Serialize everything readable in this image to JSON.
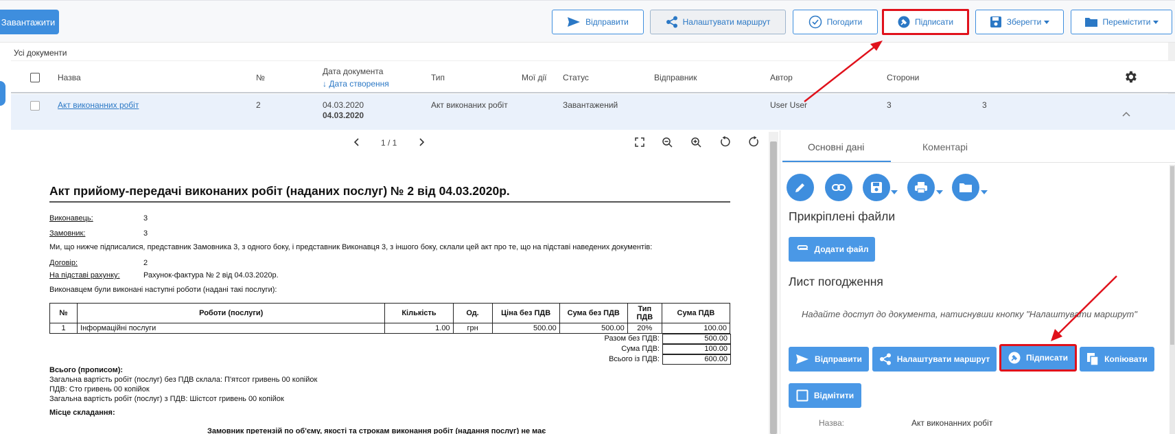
{
  "toolbar": {
    "upload": "Завантажити",
    "send": "Відправити",
    "route": "Налаштувати маршрут",
    "approve": "Погодити",
    "sign": "Підписати",
    "save": "Зберегти",
    "move": "Перемістити"
  },
  "breadcrumb": "Усі документи",
  "table": {
    "headers": {
      "name": "Назва",
      "number": "№",
      "date": "Дата документа",
      "created": "↓ Дата створення",
      "type": "Тип",
      "my_actions": "Мої дії",
      "status": "Статус",
      "sender": "Відправник",
      "author": "Автор",
      "parties": "Сторони"
    },
    "row": {
      "name": "Акт виконанних робіт",
      "number": "2",
      "date": "04.03.2020",
      "created": "04.03.2020",
      "type": "Акт виконаних робіт",
      "status": "Завантажений",
      "author": "User User",
      "parties": "3",
      "extra": "3"
    }
  },
  "viewer": {
    "pages": "1 / 1"
  },
  "document": {
    "title": "Акт прийому-передачі виконаних робіт (наданих послуг) № 2 від 04.03.2020р.",
    "executor_label": "Виконавець:",
    "executor_value": "3",
    "customer_label": "Замовник:",
    "customer_value": "3",
    "intro": "Ми, що нижче підписалися, представник Замовника 3, з одного боку, і представник Виконавця 3, з іншого боку, склали цей акт про те, що на підставі наведених документів:",
    "contract_label": "Договір:",
    "contract_value": "2",
    "invoice_label": "На підставі рахунку:",
    "invoice_value": "Рахунок-фактура № 2 від 04.03.2020р.",
    "works_intro": "Виконавцем були виконані наступні роботи (надані такі послуги):",
    "columns": [
      "№",
      "Роботи (послуги)",
      "Кількість",
      "Од.",
      "Ціна без ПДВ",
      "Сума без ПДВ",
      "Тип ПДВ",
      "Сума ПДВ"
    ],
    "rows": [
      [
        "1",
        "Інформаційні послуги",
        "1.00",
        "грн",
        "500.00",
        "500.00",
        "20%",
        "100.00"
      ]
    ],
    "totals": [
      {
        "label": "Разом без ПДВ:",
        "value": "500.00"
      },
      {
        "label": "Сума ПДВ:",
        "value": "100.00"
      },
      {
        "label": "Всього із ПДВ:",
        "value": "600.00"
      }
    ],
    "words_title": "Всього (прописом):",
    "words_1": "Загальна вартість робіт (послуг) без ПДВ склала:  П'ятсот гривень 00 копійок",
    "words_2": "ПДВ:  Сто гривень 00 копійок",
    "words_3": "Загальна вартість робіт (послуг) з ПДВ:  Шістсот гривень 00 копійок",
    "place_title": "Місце складання:",
    "claims": "Замовник претензій по об'єму, якості та строкам виконання робіт (надання послуг) не має"
  },
  "panel": {
    "tab_main": "Основні дані",
    "tab_comments": "Коментарі",
    "attached_title": "Прикріплені файли",
    "add_file": "Додати файл",
    "approval_title": "Лист погодження",
    "hint": "Надайте доступ до документа, натиснувши кнопку \"Налаштувати маршрут\"",
    "send": "Відправити",
    "route": "Налаштувати маршрут",
    "sign": "Підписати",
    "copy": "Копіювати",
    "mark": "Відмітити",
    "name_label": "Назва:",
    "name_value": "Акт виконанних робіт"
  },
  "colors": {
    "accent": "#3e8ede",
    "highlight": "#e0111b"
  }
}
